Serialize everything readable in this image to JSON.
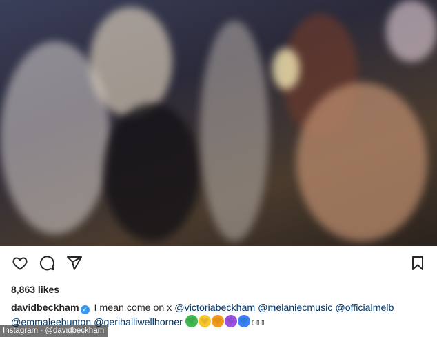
{
  "post": {
    "image_alt": "Group selfie of women dancing at a party with a smiling man in the foreground",
    "actions": {
      "like_icon": "heart-outline-icon",
      "comment_icon": "comment-bubble-icon",
      "share_icon": "paper-plane-icon",
      "save_icon": "bookmark-outline-icon"
    },
    "likes_text": "8,863 likes",
    "caption": {
      "username": "davidbeckham",
      "text": "I mean come on x",
      "mentions_line1": [
        "@victoriabeckham",
        "@melaniecmusic",
        "@officialmelb"
      ],
      "mentions_line2": [
        "@emmaleebunton",
        "@gerihalliwellhorner"
      ],
      "emojis": [
        {
          "name": "green-heart-icon",
          "color": "#3fb950"
        },
        {
          "name": "yellow-heart-icon",
          "color": "#f7c52d"
        },
        {
          "name": "orange-heart-icon",
          "color": "#f39a1e"
        },
        {
          "name": "purple-heart-icon",
          "color": "#9b51e0"
        },
        {
          "name": "blue-heart-icon",
          "color": "#3b82f6"
        }
      ],
      "trailing_glyphs": "▯▯▯"
    },
    "credit": "Instagram - @davidbeckham"
  }
}
